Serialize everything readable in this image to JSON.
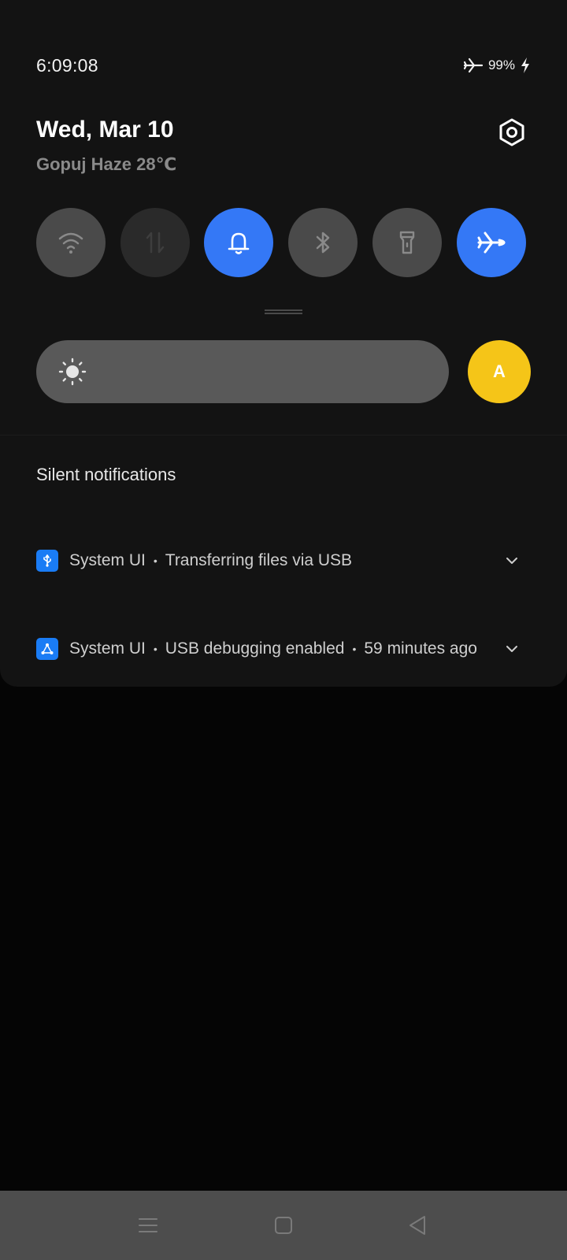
{
  "status_bar": {
    "time": "6:09:08",
    "battery": "99%",
    "icons": [
      "airplane-mode-icon",
      "battery-charging-icon"
    ]
  },
  "header": {
    "date": "Wed, Mar 10",
    "weather": "Gopuj Haze 28℃",
    "settings_icon": "settings-icon"
  },
  "quick_tiles": [
    {
      "name": "wifi",
      "icon": "wifi-icon",
      "state": "off"
    },
    {
      "name": "mobile-data",
      "icon": "mobile-data-icon",
      "state": "disabled"
    },
    {
      "name": "sound",
      "icon": "bell-icon",
      "state": "on"
    },
    {
      "name": "bluetooth",
      "icon": "bluetooth-icon",
      "state": "off"
    },
    {
      "name": "flashlight",
      "icon": "flashlight-icon",
      "state": "off"
    },
    {
      "name": "airplane-mode",
      "icon": "airplane-icon",
      "state": "on"
    }
  ],
  "brightness": {
    "icon": "sun-icon",
    "auto_label": "A"
  },
  "notifications": {
    "section_title": "Silent notifications",
    "items": [
      {
        "icon": "usb-icon",
        "app": "System UI",
        "text": "Transferring files via USB",
        "time": ""
      },
      {
        "icon": "usb-debug-icon",
        "app": "System UI",
        "text": "USB debugging enabled",
        "time": "59 minutes ago"
      }
    ]
  },
  "nav_bar": {
    "buttons": [
      "menu-icon",
      "home-icon",
      "back-icon"
    ]
  },
  "colors": {
    "accent": "#3478f6",
    "tile_off": "#4a4a4a",
    "auto_brightness": "#f5c518",
    "panel_bg": "#131313"
  }
}
